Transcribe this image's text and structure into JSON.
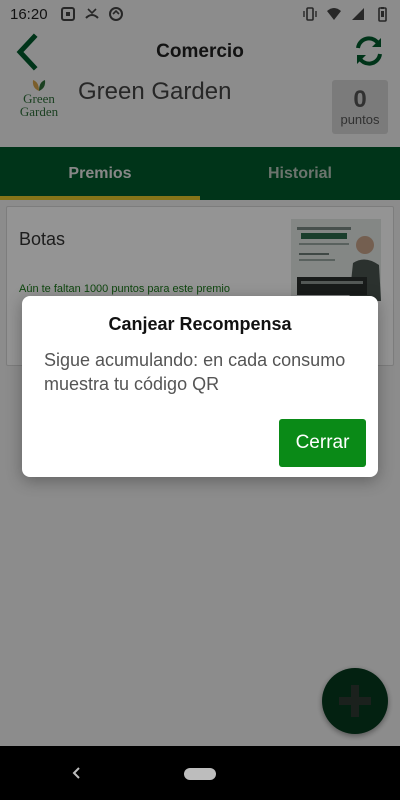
{
  "status_bar": {
    "time": "16:20",
    "left_icons": [
      "screenshot-icon",
      "missed-call-icon",
      "sync-icon"
    ],
    "right_icons": [
      "vibrate-icon",
      "wifi-icon",
      "signal-icon",
      "battery-icon"
    ]
  },
  "app_bar": {
    "title": "Comercio",
    "back_icon": "chevron-left-icon",
    "refresh_icon": "refresh-icon"
  },
  "store": {
    "name": "Green Garden",
    "logo_line1": "Green",
    "logo_line2": "Garden",
    "points_value": "0",
    "points_label": "puntos"
  },
  "tabs": [
    {
      "label": "Premios",
      "active": true
    },
    {
      "label": "Historial",
      "active": false
    }
  ],
  "reward": {
    "title": "Botas",
    "note": "Aún te faltan 1000 puntos para este premio"
  },
  "dialog": {
    "title": "Canjear Recompensa",
    "message": "Sigue acumulando: en cada consumo muestra tu código QR",
    "button_label": "Cerrar"
  },
  "fab": {
    "icon": "plus-icon"
  },
  "colors": {
    "primary": "#005a2c",
    "accent": "#e5c92c",
    "button": "#0a8a17",
    "fab": "#063a1e"
  }
}
